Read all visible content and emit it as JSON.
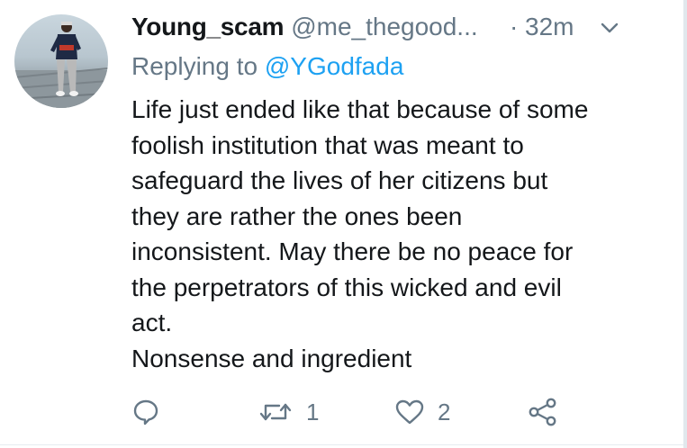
{
  "tweet": {
    "author": {
      "display_name": "Young_scam",
      "handle": "@me_thegood...",
      "avatar_icon": "user-avatar-photo"
    },
    "separator": "·",
    "time": "32m",
    "reply": {
      "prefix": "Replying to ",
      "mention": "@YGodfada"
    },
    "text_lines": [
      "Life just ended like that because of some",
      "foolish institution that was meant to",
      "safeguard the lives of her citizens but",
      "they are rather the ones been",
      "inconsistent. May there be no peace for",
      "the perpetrators of this wicked and evil",
      "act.",
      "Nonsense and ingredient"
    ],
    "actions": {
      "reply": {
        "icon": "reply-icon",
        "count": ""
      },
      "retweet": {
        "icon": "retweet-icon",
        "count": "1"
      },
      "like": {
        "icon": "heart-icon",
        "count": "2"
      },
      "share": {
        "icon": "share-icon"
      }
    },
    "menu_icon": "chevron-down-icon"
  },
  "colors": {
    "text": "#14171a",
    "secondary": "#657786",
    "link": "#1da1f2",
    "divider": "#e6ecf0"
  }
}
